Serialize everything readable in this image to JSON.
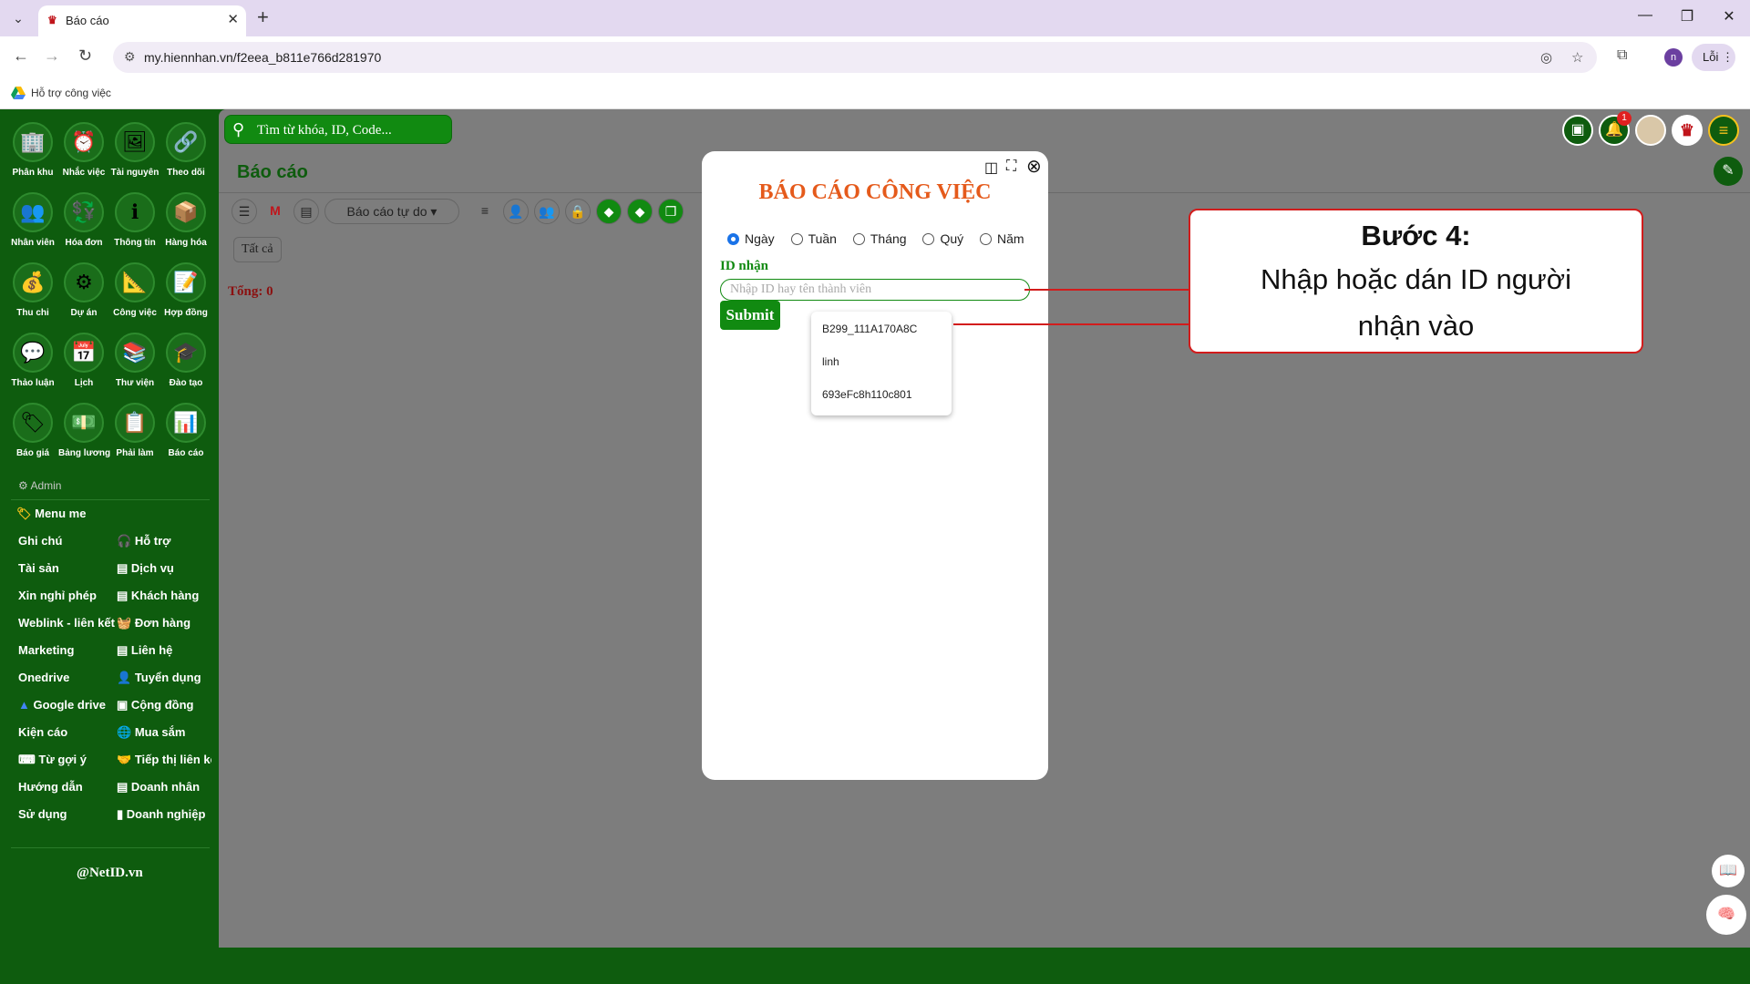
{
  "browser": {
    "tab_title": "Báo cáo",
    "url": "my.hiennhan.vn/f2eea_b811e766d281970",
    "bookmark": "Hỗ trợ công việc",
    "profile_initial": "n",
    "error_label": "Lỗi"
  },
  "sidebar": {
    "apps": [
      {
        "label": "Phân khu",
        "icon": "🏢"
      },
      {
        "label": "Nhắc việc",
        "icon": "⏰"
      },
      {
        "label": "Tài nguyên",
        "icon": "🖼"
      },
      {
        "label": "Theo dõi",
        "icon": "🔗"
      },
      {
        "label": "Nhân viên",
        "icon": "👥"
      },
      {
        "label": "Hóa đơn",
        "icon": "💱"
      },
      {
        "label": "Thông tin",
        "icon": "ℹ"
      },
      {
        "label": "Hàng hóa",
        "icon": "📦"
      },
      {
        "label": "Thu chi",
        "icon": "💰"
      },
      {
        "label": "Dự án",
        "icon": "⚙"
      },
      {
        "label": "Công việc",
        "icon": "📐"
      },
      {
        "label": "Hợp đồng",
        "icon": "📝"
      },
      {
        "label": "Thảo luận",
        "icon": "💬"
      },
      {
        "label": "Lịch",
        "icon": "📅"
      },
      {
        "label": "Thư viện",
        "icon": "📚"
      },
      {
        "label": "Đào tạo",
        "icon": "🎓"
      },
      {
        "label": "Báo giá",
        "icon": "🏷"
      },
      {
        "label": "Bảng lương",
        "icon": "💵"
      },
      {
        "label": "Phải làm",
        "icon": "📋"
      },
      {
        "label": "Báo cáo",
        "icon": "📊"
      }
    ],
    "admin_label": "Admin",
    "menu_me": "Menu me",
    "menu_left": [
      "Ghi chú",
      "Tài sản",
      "Xin nghỉ phép",
      "Weblink - liên kết",
      "Marketing",
      "Onedrive",
      "Google drive",
      "Kiện cáo",
      "Từ gợi ý",
      "Hướng dẫn",
      "Sử dụng"
    ],
    "menu_right": [
      "Hỗ trợ",
      "Dịch vụ",
      "Khách hàng",
      "Đơn hàng",
      "Liên hệ",
      "Tuyển dụng",
      "Cộng đồng",
      "Mua sắm",
      "Tiếp thị liên kế",
      "Doanh nhân",
      "Doanh nghiệp"
    ],
    "footer": "@NetID.vn"
  },
  "main": {
    "search_placeholder": "Tìm từ khóa, ID, Code...",
    "notif_count": "1",
    "page_title": "Báo cáo",
    "report_select": "Báo cáo tự do ▾",
    "filter_all": "Tất cả",
    "total": "Tổng: 0"
  },
  "modal": {
    "title": "BÁO CÁO CÔNG VIỆC",
    "periods": [
      "Ngày",
      "Tuần",
      "Tháng",
      "Quý",
      "Năm"
    ],
    "selected_period": "Ngày",
    "id_label": "ID nhận",
    "id_placeholder": "Nhập ID hay tên thành viên",
    "submit": "Submit",
    "suggestions": [
      "B299_111A170A8C",
      "linh",
      "693eFc8h110c801"
    ]
  },
  "callout": {
    "heading": "Bước 4:",
    "line1": "Nhập hoặc dán ID người",
    "line2": "nhận vào"
  },
  "colors": {
    "brand_green": "#0e5c0e",
    "accent_green": "#118a11",
    "title_orange": "#e55a1b",
    "callout_red": "#d21c1c"
  }
}
